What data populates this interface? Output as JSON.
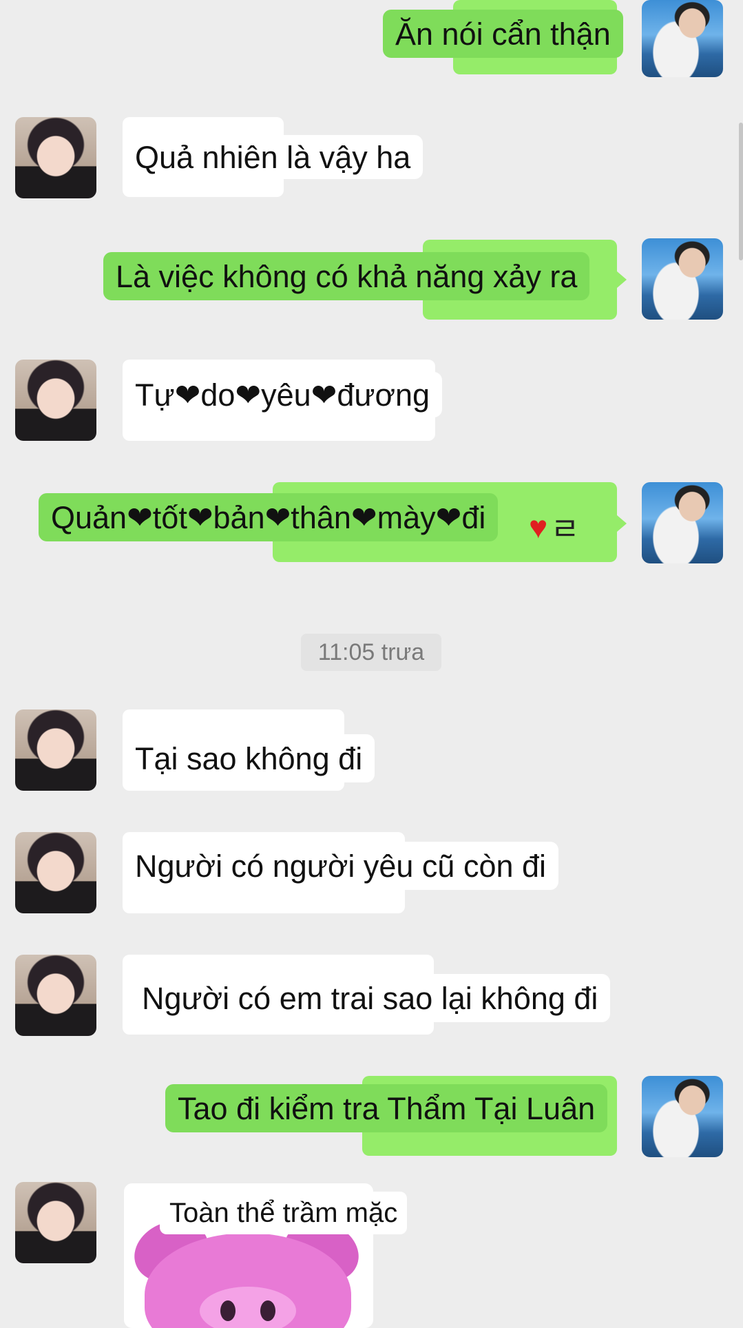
{
  "time_divider": "11:05 trưa",
  "messages": [
    {
      "from": "me",
      "text": "Ăn nói cẩn thận"
    },
    {
      "from": "them",
      "text": "Quả nhiên là vậy ha"
    },
    {
      "from": "me",
      "text": "Là việc không có khả năng xảy ra"
    },
    {
      "from": "them",
      "text": "Tự❤do❤yêu❤đương"
    },
    {
      "from": "me",
      "text": "Quản❤tốt❤bản❤thân❤mày❤đi",
      "trailing_symbol": "ㄹ"
    },
    {
      "from": "them",
      "text": "Tại sao không đi"
    },
    {
      "from": "them",
      "text": "Người có người yêu cũ còn đi"
    },
    {
      "from": "them",
      "text": "Người có em trai sao lại không đi"
    },
    {
      "from": "me",
      "text": "Tao đi kiểm tra Thẩm Tại Luân"
    },
    {
      "from": "them",
      "text": "Toàn thể trầm mặc",
      "type": "sticker",
      "sticker_icon": "pink-pig-icon"
    }
  ],
  "colors": {
    "background": "#ededed",
    "my_bubble": "#95ec69",
    "their_bubble": "#ffffff",
    "timestamp_text": "#7a7a7a"
  }
}
